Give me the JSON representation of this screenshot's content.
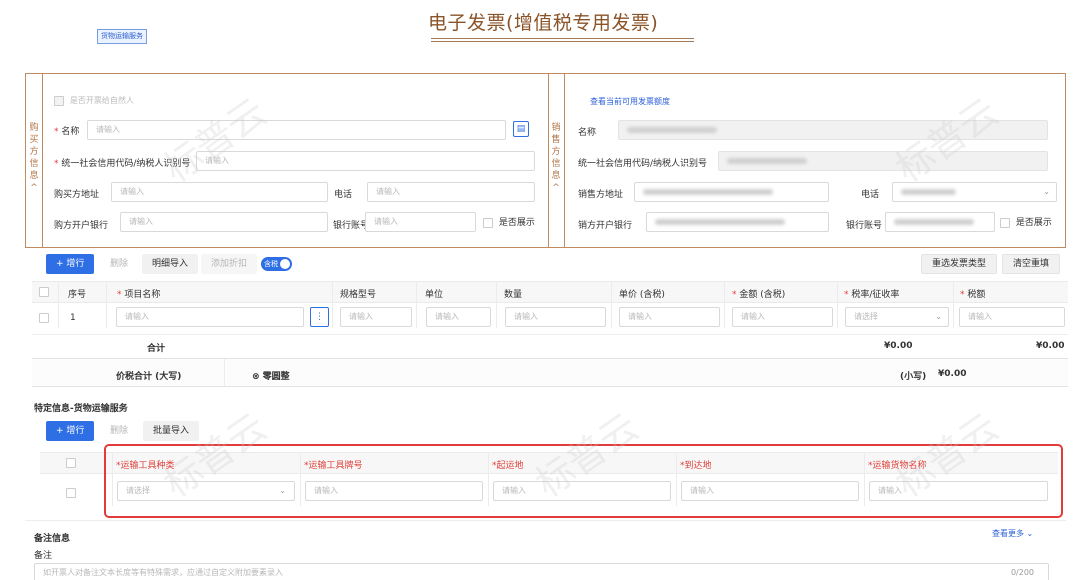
{
  "header": {
    "tag": "货物运输服务",
    "title": "电子发票(增值税专用发票)"
  },
  "buyer": {
    "side_label": [
      "购",
      "买",
      "方",
      "信",
      "息",
      "^"
    ],
    "natural_person": "是否开票给自然人",
    "name_label": "名称",
    "name_placeholder": "请输入",
    "taxid_label": "统一社会信用代码/纳税人识别号",
    "taxid_placeholder": "请输入",
    "address_label": "购买方地址",
    "address_placeholder": "请输入",
    "phone_label": "电话",
    "phone_placeholder": "请输入",
    "bank_label": "购方开户银行",
    "bank_placeholder": "请输入",
    "account_label": "银行账号",
    "account_placeholder": "请输入",
    "show_label": "是否展示"
  },
  "seller": {
    "side_label": [
      "销",
      "售",
      "方",
      "信",
      "息",
      "^"
    ],
    "quota_link": "查看当前可用发票额度",
    "name_label": "名称",
    "taxid_label": "统一社会信用代码/纳税人识别号",
    "address_label": "销售方地址",
    "phone_label": "电话",
    "bank_label": "销方开户银行",
    "account_label": "银行账号",
    "show_label": "是否展示"
  },
  "toolbar": {
    "add": "+ 增行",
    "delete": "删除",
    "import": "明细导入",
    "discount": "添加折扣",
    "tax_toggle": "含税",
    "reselect": "重选发票类型",
    "clear": "清空重填"
  },
  "items_table": {
    "headers": [
      "序号",
      "项目名称",
      "规格型号",
      "单位",
      "数量",
      "单价 (含税)",
      "金额 (含税)",
      "税率/征收率",
      "税额"
    ],
    "required": [
      false,
      true,
      false,
      false,
      false,
      false,
      true,
      true,
      true
    ],
    "row": {
      "index": "1",
      "name": "请输入",
      "spec": "请输入",
      "unit": "请输入",
      "qty": "请输入",
      "price": "请输入",
      "amount": "请输入",
      "rate": "请选择",
      "tax": "请输入"
    },
    "subtotal_label": "合计",
    "subtotal_amount": "¥0.00",
    "subtotal_tax": "¥0.00",
    "total_label": "价税合计 (大写)",
    "total_words": "⊗ 零圆整",
    "total_small_label": "(小写)",
    "total_small": "¥0.00"
  },
  "transport": {
    "section_title": "特定信息-货物运输服务",
    "add": "+ 增行",
    "delete": "删除",
    "batch_import": "批量导入",
    "headers": [
      "*运输工具种类",
      "*运输工具牌号",
      "*起运地",
      "*到达地",
      "*运输货物名称"
    ],
    "row": {
      "type": "请选择",
      "plate": "请输入",
      "origin": "请输入",
      "dest": "请输入",
      "goods": "请输入"
    }
  },
  "remarks": {
    "section_title": "备注信息",
    "more": "查看更多",
    "label": "备注",
    "placeholder": "如开票人对备注文本长度等有特殊需求，应通过自定义附加要素录入",
    "counter": "0/200"
  },
  "watermark": "标普云",
  "colors": {
    "brown": "#8a5328",
    "border": "#c08a63",
    "primary": "#2f6fe6",
    "required": "#e0403a",
    "highlight": "#e23b3b"
  }
}
